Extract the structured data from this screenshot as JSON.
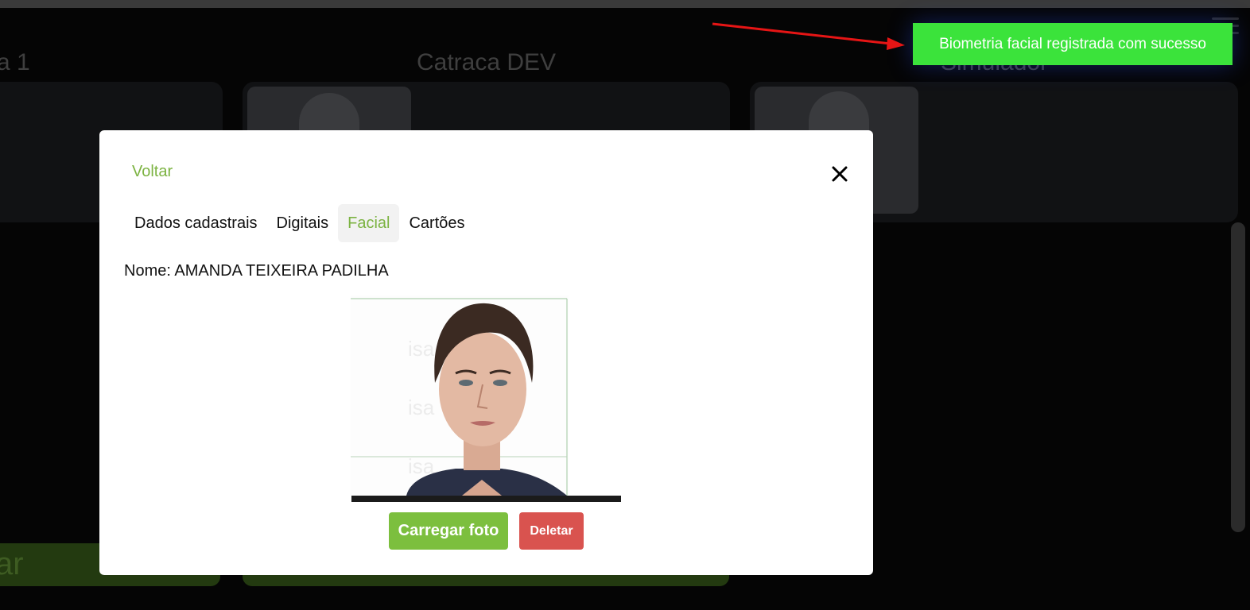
{
  "background": {
    "cards": [
      {
        "title": "a 1",
        "button_label": "ar"
      },
      {
        "title": "Catraca DEV",
        "button_label": ""
      },
      {
        "title": "Simulador",
        "button_label": ""
      }
    ]
  },
  "toast": {
    "message": "Biometria facial registrada com sucesso",
    "color": "#3be33b"
  },
  "annotation": {
    "arrow_color": "#e61515"
  },
  "modal": {
    "back_label": "Voltar",
    "close_icon": "close-icon",
    "tabs": [
      {
        "label": "Dados cadastrais",
        "active": false
      },
      {
        "label": "Digitais",
        "active": false
      },
      {
        "label": "Facial",
        "active": true
      },
      {
        "label": "Cartões",
        "active": false
      }
    ],
    "name_label": "Nome:",
    "name_value": "AMANDA TEIXEIRA PADILHA",
    "photo_watermark": "isa",
    "buttons": {
      "upload_label": "Carregar foto",
      "delete_label": "Deletar"
    },
    "accent_color": "#7cb342",
    "danger_color": "#d9534f"
  }
}
